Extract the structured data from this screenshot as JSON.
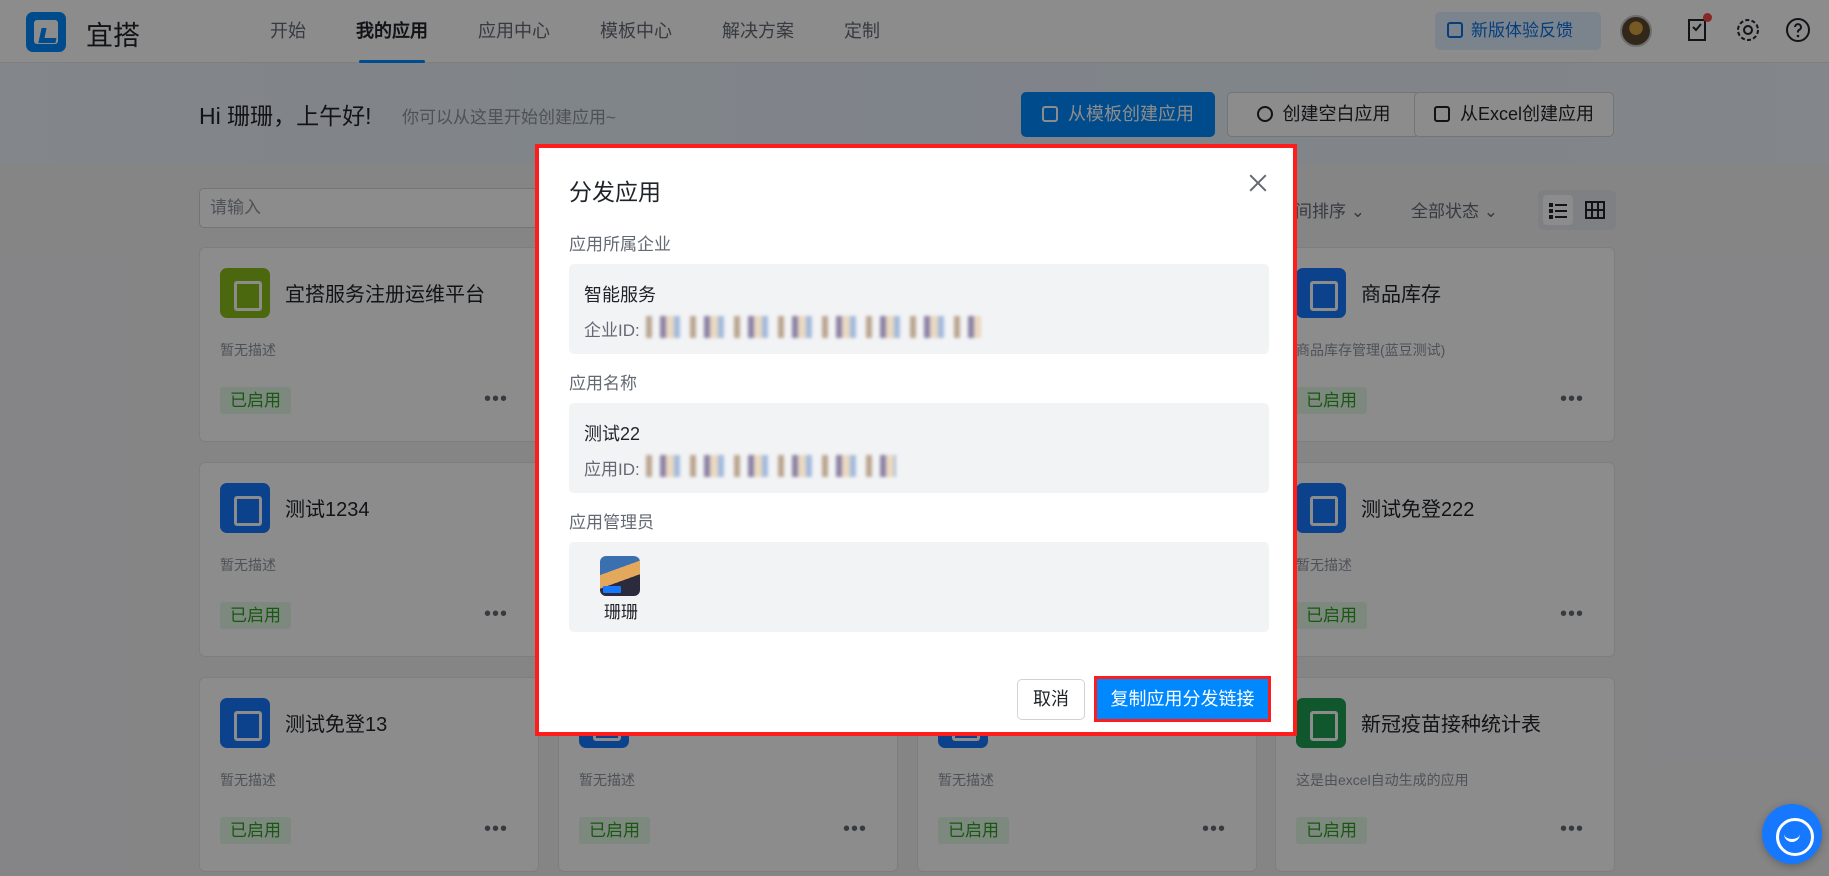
{
  "brand": {
    "name": "宜搭"
  },
  "nav": {
    "items": [
      "开始",
      "我的应用",
      "应用中心",
      "模板中心",
      "解决方案",
      "定制"
    ],
    "active": "我的应用"
  },
  "header": {
    "feedback_label": "新版体验反馈"
  },
  "banner": {
    "greeting": "Hi 珊珊，上午好!",
    "subtitle": "你可以从这里开始创建应用~",
    "template_button": "从模板创建应用",
    "blank_button": "创建空白应用",
    "excel_button": "从Excel创建应用"
  },
  "filters": {
    "search_placeholder": "请输入",
    "sort_label": "间排序",
    "status_label": "全部状态"
  },
  "cards": [
    {
      "title": "宜搭服务注册运维平台",
      "desc": "暂无描述",
      "status": "已启用",
      "icon": "monitor-icon",
      "color": "#8bbe1c"
    },
    {
      "title": "商品库存",
      "desc": "商品库存管理(蓝豆测试)",
      "status": "已启用",
      "icon": "bank-icon",
      "color": "#1677ff"
    },
    {
      "title": "测试1234",
      "desc": "暂无描述",
      "status": "已启用",
      "icon": "form-icon",
      "color": "#1677ff"
    },
    {
      "title": "测试免登222",
      "desc": "暂无描述",
      "status": "已启用",
      "icon": "form-icon",
      "color": "#1677ff"
    },
    {
      "title": "测试免登13",
      "desc": "暂无描述",
      "status": "已启用",
      "icon": "form-icon",
      "color": "#1677ff"
    },
    {
      "title": "",
      "desc": "暂无描述",
      "status": "已启用",
      "icon": "form-icon",
      "color": "#1677ff"
    },
    {
      "title": "",
      "desc": "暂无描述",
      "status": "已启用",
      "icon": "form-icon",
      "color": "#1677ff"
    },
    {
      "title": "新冠疫苗接种统计表",
      "desc": "这是由excel自动生成的应用",
      "status": "已启用",
      "icon": "excel-icon",
      "color": "#1e9f55"
    }
  ],
  "dialog": {
    "title": "分发应用",
    "org_label": "应用所属企业",
    "org_name": "智能服务",
    "org_id_label": "企业ID:",
    "app_label": "应用名称",
    "app_name": "测试22",
    "app_id_label": "应用ID:",
    "admin_label": "应用管理员",
    "admin_name": "珊珊",
    "cancel": "取消",
    "copy": "复制应用分发链接"
  }
}
